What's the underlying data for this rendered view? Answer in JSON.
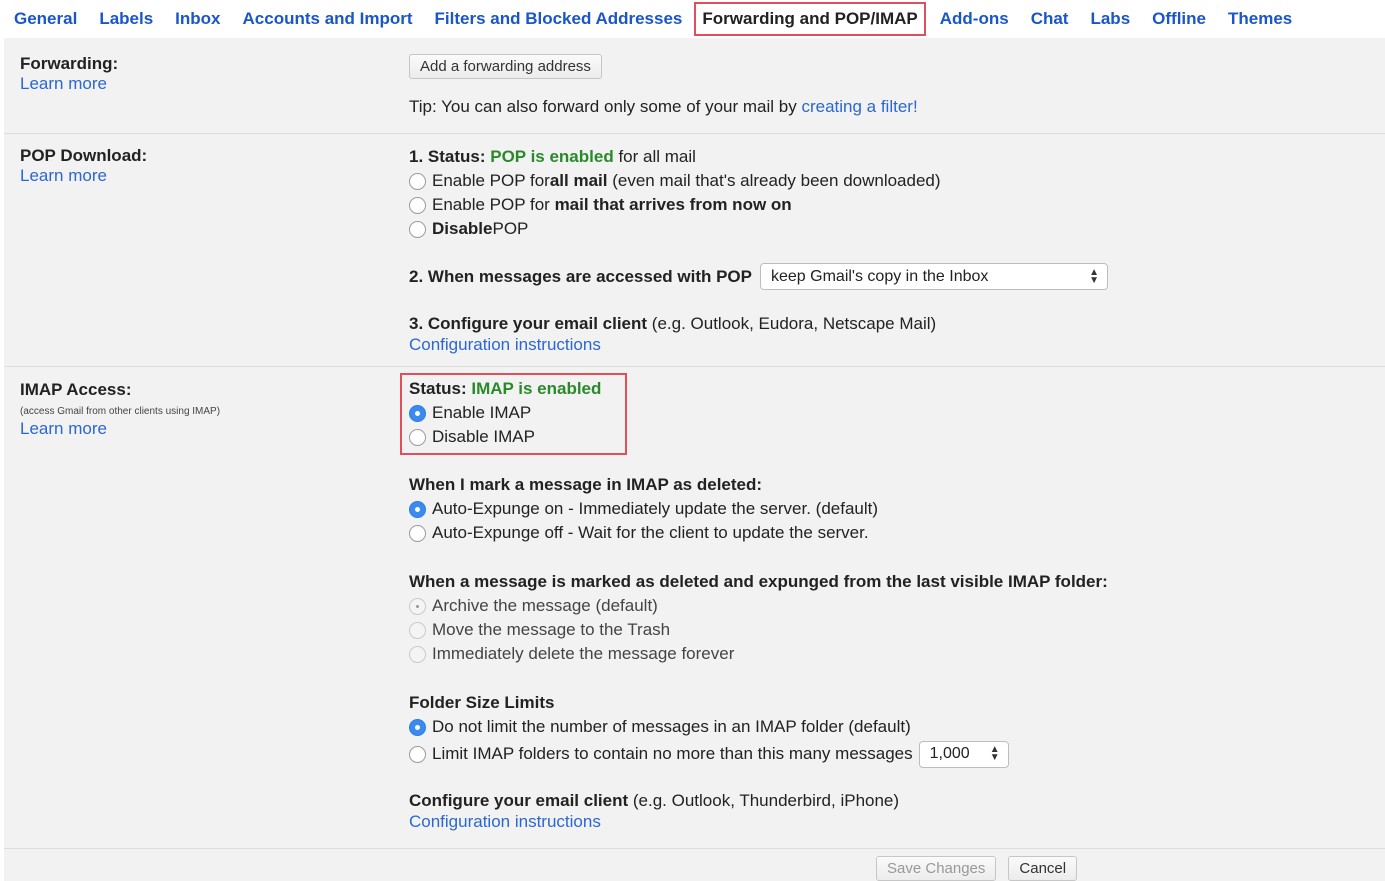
{
  "tabs": [
    "General",
    "Labels",
    "Inbox",
    "Accounts and Import",
    "Filters and Blocked Addresses",
    "Forwarding and POP/IMAP",
    "Add-ons",
    "Chat",
    "Labs",
    "Offline",
    "Themes"
  ],
  "forwarding": {
    "title": "Forwarding:",
    "learn_more": "Learn more",
    "add_button": "Add a forwarding address",
    "tip_prefix": "Tip: You can also forward only some of your mail by ",
    "tip_link": "creating a filter!"
  },
  "pop": {
    "title": "POP Download:",
    "learn_more": "Learn more",
    "status_label": "1. Status: ",
    "status_value": "POP is enabled",
    "status_suffix": " for all mail",
    "opt1_pre": "Enable POP for ",
    "opt1_bold": "all mail",
    "opt1_post": " (even mail that's already been downloaded)",
    "opt2_pre": "Enable POP for ",
    "opt2_bold": "mail that arrives from now on",
    "opt3_bold": "Disable",
    "opt3_post": " POP",
    "access_label": "2. When messages are accessed with POP",
    "access_value": "keep Gmail's copy in the Inbox",
    "configure_bold": "3. Configure your email client",
    "configure_rest": " (e.g. Outlook, Eudora, Netscape Mail)",
    "config_link": "Configuration instructions"
  },
  "imap": {
    "title": "IMAP Access:",
    "note": "(access Gmail from other clients using IMAP)",
    "learn_more": "Learn more",
    "status_label": "Status: ",
    "status_value": "IMAP is enabled",
    "enable": "Enable IMAP",
    "disable": "Disable IMAP",
    "deleted_title": "When I mark a message in IMAP as deleted:",
    "expunge_on": "Auto-Expunge on - Immediately update the server. (default)",
    "expunge_off": "Auto-Expunge off - Wait for the client to update the server.",
    "expunged_title": "When a message is marked as deleted and expunged from the last visible IMAP folder:",
    "archive": "Archive the message (default)",
    "trash": "Move the message to the Trash",
    "delete_forever": "Immediately delete the message forever",
    "folder_title": "Folder Size Limits",
    "no_limit": "Do not limit the number of messages in an IMAP folder (default)",
    "limit": "Limit IMAP folders to contain no more than this many messages",
    "limit_value": "1,000",
    "configure_bold": "Configure your email client",
    "configure_rest": " (e.g. Outlook, Thunderbird, iPhone)",
    "config_link": "Configuration instructions"
  },
  "footer": {
    "save": "Save Changes",
    "cancel": "Cancel"
  },
  "colors": {
    "link": "#2a67d3",
    "enabled_green": "#2a8a2a",
    "highlight_red": "#e0505a",
    "radio_blue": "#3b8af0"
  }
}
